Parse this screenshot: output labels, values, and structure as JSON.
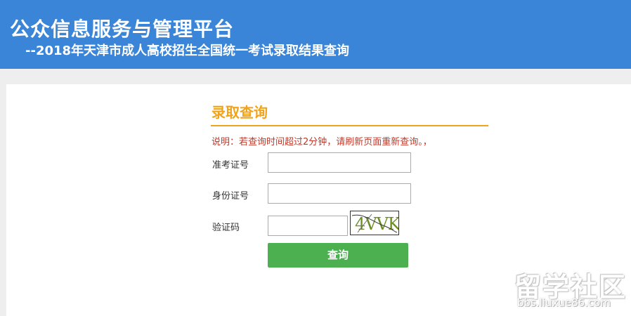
{
  "header": {
    "title": "公众信息服务与管理平台",
    "subtitle": "--2018年天津市成人高校招生全国统一考试录取结果查询"
  },
  "form": {
    "title": "录取查询",
    "notice": "说明：若查询时间超过2分钟，请刷新页面重新查询。，",
    "fields": {
      "exam_number_label": "准考证号",
      "exam_number_value": "",
      "id_number_label": "身份证号",
      "id_number_value": "",
      "captcha_label": "验证码",
      "captcha_value": ""
    },
    "captcha_text": "4VVK",
    "submit_label": "查询"
  },
  "watermark": {
    "main": "留学社区",
    "url": "bbs.liuxue86.com"
  },
  "colors": {
    "header_bg": "#3a85d8",
    "accent": "#f0a41c",
    "notice": "#c0392b",
    "button": "#4caf50"
  }
}
